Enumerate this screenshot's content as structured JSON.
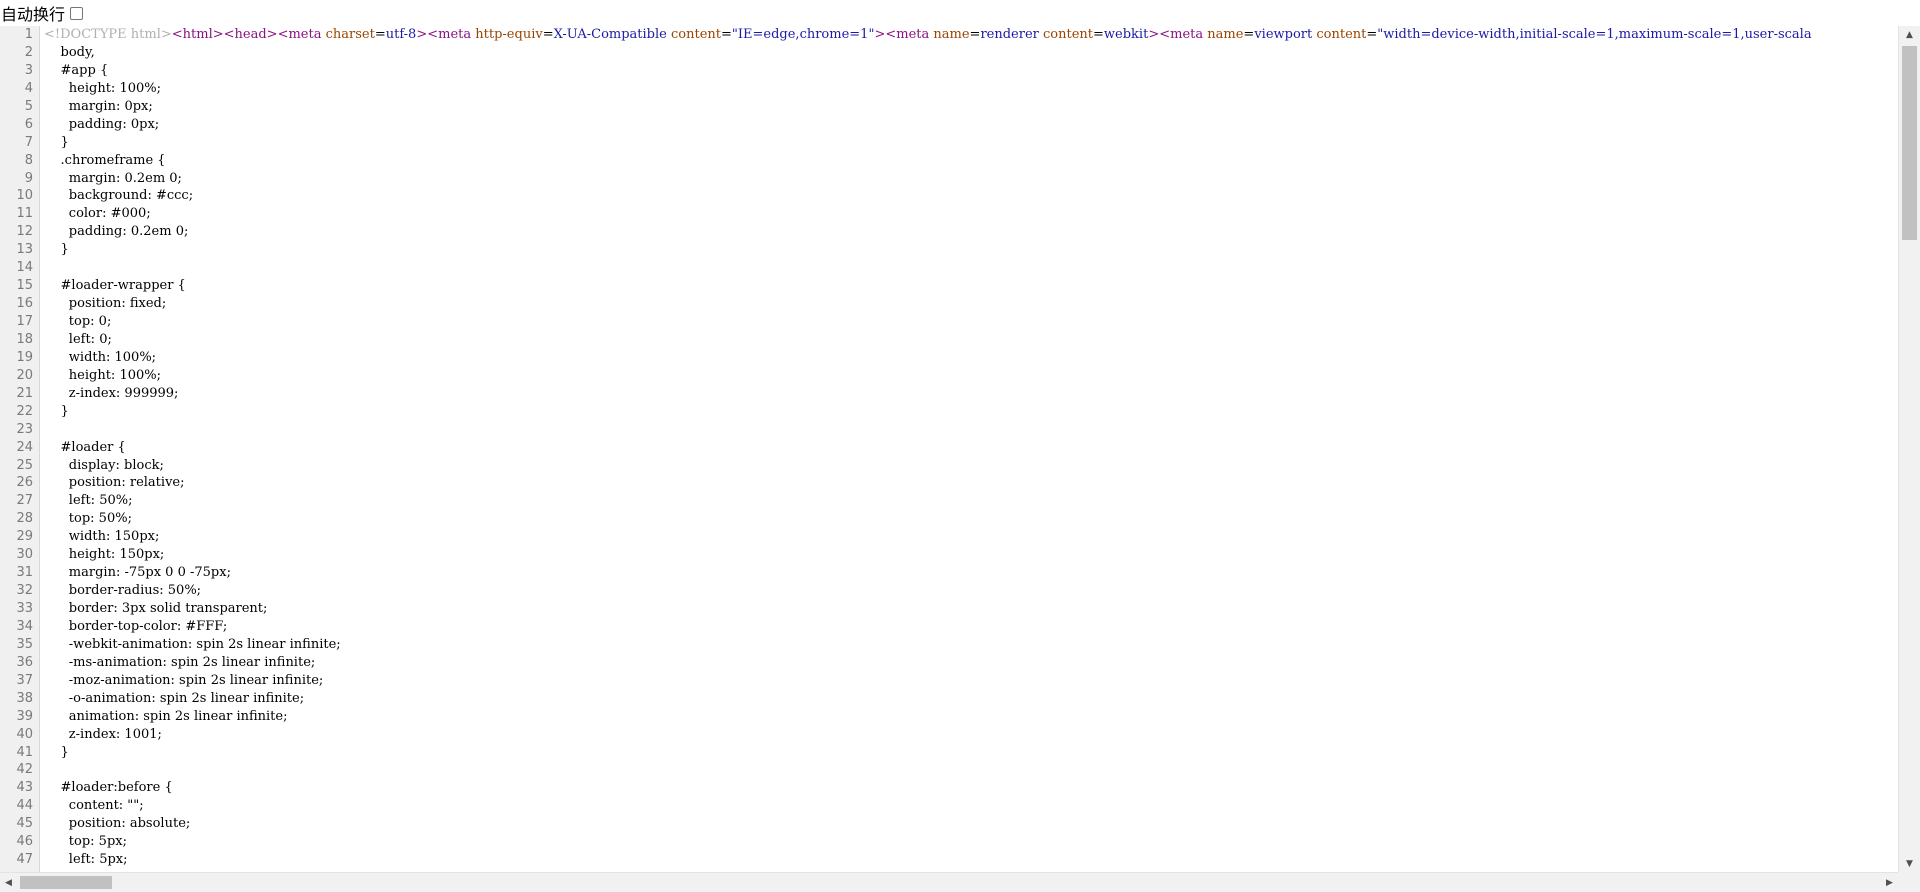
{
  "toolbar": {
    "wrap_label": "自动换行",
    "wrap_checked": false
  },
  "source": {
    "first_line": {
      "doctype": "<!DOCTYPE html>",
      "parts": [
        {
          "cls": "t-tag",
          "text": "<html>"
        },
        {
          "cls": "t-tag",
          "text": "<head>"
        },
        {
          "cls": "t-tag",
          "text": "<meta "
        },
        {
          "cls": "t-attr",
          "text": "charset"
        },
        {
          "cls": "t-plain",
          "text": "="
        },
        {
          "cls": "t-val",
          "text": "utf-8"
        },
        {
          "cls": "t-tag",
          "text": ">"
        },
        {
          "cls": "t-tag",
          "text": "<meta "
        },
        {
          "cls": "t-attr",
          "text": "http-equiv"
        },
        {
          "cls": "t-plain",
          "text": "="
        },
        {
          "cls": "t-val",
          "text": "X-UA-Compatible"
        },
        {
          "cls": "t-plain",
          "text": " "
        },
        {
          "cls": "t-attr",
          "text": "content"
        },
        {
          "cls": "t-plain",
          "text": "="
        },
        {
          "cls": "t-val",
          "text": "\"IE=edge,chrome=1\""
        },
        {
          "cls": "t-tag",
          "text": ">"
        },
        {
          "cls": "t-tag",
          "text": "<meta "
        },
        {
          "cls": "t-attr",
          "text": "name"
        },
        {
          "cls": "t-plain",
          "text": "="
        },
        {
          "cls": "t-val",
          "text": "renderer"
        },
        {
          "cls": "t-plain",
          "text": " "
        },
        {
          "cls": "t-attr",
          "text": "content"
        },
        {
          "cls": "t-plain",
          "text": "="
        },
        {
          "cls": "t-val",
          "text": "webkit"
        },
        {
          "cls": "t-tag",
          "text": ">"
        },
        {
          "cls": "t-tag",
          "text": "<meta "
        },
        {
          "cls": "t-attr",
          "text": "name"
        },
        {
          "cls": "t-plain",
          "text": "="
        },
        {
          "cls": "t-val",
          "text": "viewport"
        },
        {
          "cls": "t-plain",
          "text": " "
        },
        {
          "cls": "t-attr",
          "text": "content"
        },
        {
          "cls": "t-plain",
          "text": "="
        },
        {
          "cls": "t-val",
          "text": "\"width=device-width,initial-scale=1,maximum-scale=1,user-scala"
        }
      ]
    },
    "lines": [
      "    body,",
      "    #app {",
      "      height: 100%;",
      "      margin: 0px;",
      "      padding: 0px;",
      "    }",
      "    .chromeframe {",
      "      margin: 0.2em 0;",
      "      background: #ccc;",
      "      color: #000;",
      "      padding: 0.2em 0;",
      "    }",
      "",
      "    #loader-wrapper {",
      "      position: fixed;",
      "      top: 0;",
      "      left: 0;",
      "      width: 100%;",
      "      height: 100%;",
      "      z-index: 999999;",
      "    }",
      "",
      "    #loader {",
      "      display: block;",
      "      position: relative;",
      "      left: 50%;",
      "      top: 50%;",
      "      width: 150px;",
      "      height: 150px;",
      "      margin: -75px 0 0 -75px;",
      "      border-radius: 50%;",
      "      border: 3px solid transparent;",
      "      border-top-color: #FFF;",
      "      -webkit-animation: spin 2s linear infinite;",
      "      -ms-animation: spin 2s linear infinite;",
      "      -moz-animation: spin 2s linear infinite;",
      "      -o-animation: spin 2s linear infinite;",
      "      animation: spin 2s linear infinite;",
      "      z-index: 1001;",
      "    }",
      "",
      "    #loader:before {",
      "      content: \"\";",
      "      position: absolute;",
      "      top: 5px;",
      "      left: 5px;"
    ]
  },
  "scrollbars": {
    "up_arrow": "▲",
    "down_arrow": "▼",
    "left_arrow": "◀",
    "right_arrow": "▶"
  }
}
